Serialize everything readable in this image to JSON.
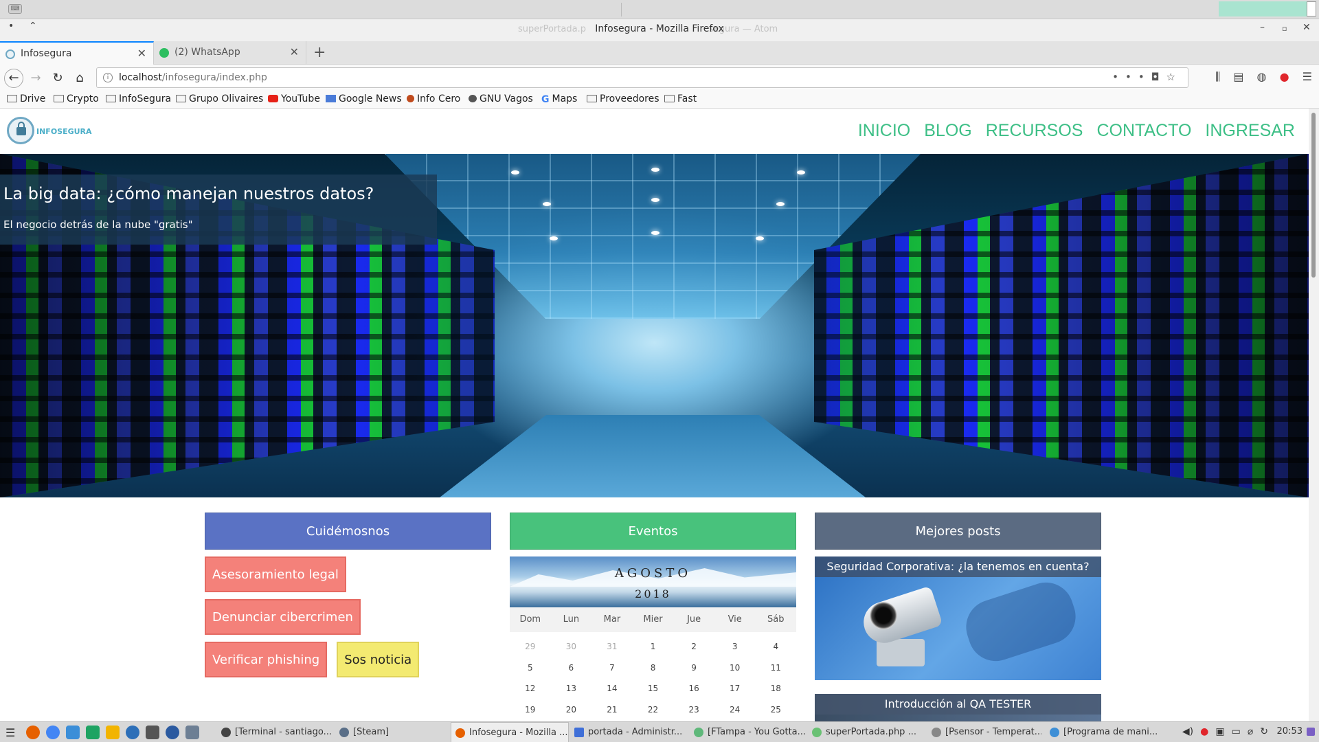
{
  "system": {
    "window_title": "Infosegura - Mozilla Firefox",
    "ghost_left": "superPortada.p",
    "ghost_right": "segura — Atom"
  },
  "tabs": [
    {
      "label": "Infosegura",
      "active": true
    },
    {
      "label": "(2) WhatsApp",
      "active": false
    }
  ],
  "url": {
    "host": "localhost",
    "path": "/infosegura/index.php"
  },
  "bookmarks": [
    {
      "label": "Drive",
      "icon": "folder"
    },
    {
      "label": "Crypto",
      "icon": "folder"
    },
    {
      "label": "InfoSegura",
      "icon": "folder"
    },
    {
      "label": "Grupo Olivaires",
      "icon": "folder"
    },
    {
      "label": "YouTube",
      "icon": "youtube"
    },
    {
      "label": "Google News",
      "icon": "google-news"
    },
    {
      "label": "Info Cero",
      "icon": "info-cero"
    },
    {
      "label": "GNU Vagos",
      "icon": "gnu"
    },
    {
      "label": "Maps",
      "icon": "google"
    },
    {
      "label": "Proveedores",
      "icon": "folder"
    },
    {
      "label": "Fast",
      "icon": "folder"
    }
  ],
  "site": {
    "brand": "INFOSEGURA",
    "nav": [
      "INICIO",
      "BLOG",
      "RECURSOS",
      "CONTACTO",
      "INGRESAR"
    ],
    "hero": {
      "title": "La big data: ¿cómo manejan nuestros datos?",
      "subtitle": "El negocio detrás de la nube \"gratis\""
    },
    "cuidemosnos": {
      "title": "Cuidémosnos",
      "color": "#5a72c4",
      "buttons": [
        "Asesoramiento legal",
        "Denunciar cibercrimen",
        "Verificar phishing",
        "Sos noticia"
      ]
    },
    "eventos": {
      "title": "Eventos",
      "color": "#48c27c",
      "month": "AGOSTO",
      "year": "2018",
      "weekdays": [
        "Dom",
        "Lun",
        "Mar",
        "Mier",
        "Jue",
        "Vie",
        "Sáb"
      ],
      "weeks": [
        [
          "29",
          "30",
          "31",
          "1",
          "2",
          "3",
          "4"
        ],
        [
          "5",
          "6",
          "7",
          "8",
          "9",
          "10",
          "11"
        ],
        [
          "12",
          "13",
          "14",
          "15",
          "16",
          "17",
          "18"
        ],
        [
          "19",
          "20",
          "21",
          "22",
          "23",
          "24",
          "25"
        ]
      ]
    },
    "mejores": {
      "title": "Mejores posts",
      "color": "#5b6b82",
      "posts": [
        "Seguridad Corporativa: ¿la tenemos en cuenta?",
        "Introducción al QA TESTER"
      ]
    }
  },
  "taskbar": {
    "tasks": [
      {
        "label": "[Terminal - santiago...",
        "color": "#444444"
      },
      {
        "label": "[Steam]",
        "color": "#5a6f88"
      },
      {
        "label": "Infosegura - Mozilla ...",
        "color": "#e66000",
        "active": true
      },
      {
        "label": "portada - Administr...",
        "color": "#3f6fd8"
      },
      {
        "label": "[FTampa - You Gotta...",
        "color": "#5fb87a"
      },
      {
        "label": "superPortada.php ...",
        "color": "#6ac174"
      },
      {
        "label": "[Psensor - Temperat...",
        "color": "#888888"
      },
      {
        "label": "[Programa de mani...",
        "color": "#3e8fd6"
      }
    ],
    "clock": "20:53"
  }
}
